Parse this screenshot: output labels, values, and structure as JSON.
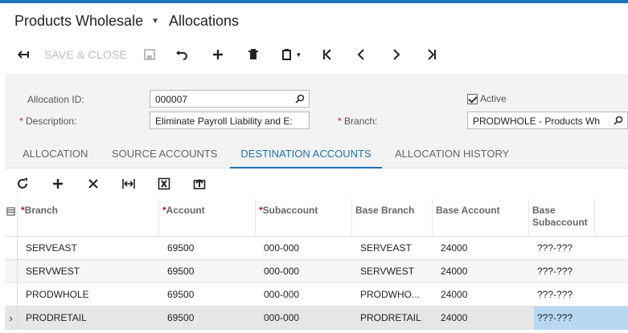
{
  "header": {
    "company": "Products Wholesale",
    "screen": "Allocations",
    "save_close": "SAVE & CLOSE"
  },
  "form": {
    "allocation_id_label": "Allocation ID:",
    "allocation_id": "000007",
    "description_label": "Description:",
    "description": "Eliminate Payroll Liability and E:",
    "branch_label": "Branch:",
    "branch": "PRODWHOLE - Products Wh",
    "active_label": "Active",
    "required_mark": "*"
  },
  "tabs": [
    "ALLOCATION",
    "SOURCE ACCOUNTS",
    "DESTINATION ACCOUNTS",
    "ALLOCATION HISTORY"
  ],
  "grid": {
    "columns": [
      "Branch",
      "Account",
      "Subaccount",
      "Base Branch",
      "Base Account",
      "Base Subaccount"
    ],
    "required_mark": "*",
    "rows": [
      [
        "SERVEAST",
        "69500",
        "000-000",
        "SERVEAST",
        "24000",
        "???-???"
      ],
      [
        "SERVWEST",
        "69500",
        "000-000",
        "SERVWEST",
        "24000",
        "???-???"
      ],
      [
        "PRODWHOLE",
        "69500",
        "000-000",
        "PRODWHO...",
        "24000",
        "???-???"
      ],
      [
        "PRODRETAIL",
        "69500",
        "000-000",
        "PRODRETAIL",
        "24000",
        "???-???"
      ]
    ],
    "current_row_marker": "›"
  },
  "colors": {
    "accent": "#1f73b7",
    "selected_cell": "#b7d7f2"
  }
}
